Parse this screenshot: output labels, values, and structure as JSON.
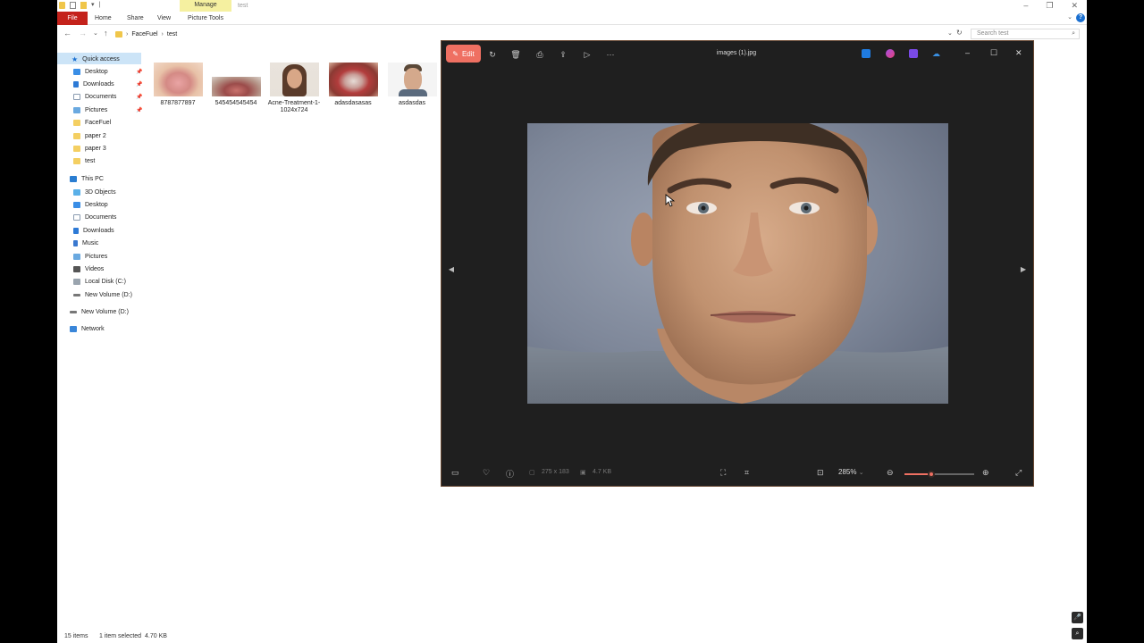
{
  "ribbon": {
    "file_tab": "File",
    "tabs": [
      "Home",
      "Share",
      "View"
    ],
    "context_group": "Manage",
    "context_tab": "Picture Tools",
    "window_title": "test"
  },
  "address": {
    "path": [
      "FaceFuel",
      "test"
    ],
    "search_placeholder": "Search test"
  },
  "nav_pane": {
    "quick_access_label": "Quick access",
    "quick_access": [
      {
        "label": "Desktop",
        "icon": "desktop-icon",
        "pinned": true
      },
      {
        "label": "Downloads",
        "icon": "download-icon",
        "pinned": true
      },
      {
        "label": "Documents",
        "icon": "document-icon",
        "pinned": true
      },
      {
        "label": "Pictures",
        "icon": "pictures-icon",
        "pinned": true
      },
      {
        "label": "FaceFuel",
        "icon": "folder-icon",
        "pinned": false
      },
      {
        "label": "paper 2",
        "icon": "folder-icon",
        "pinned": false
      },
      {
        "label": "paper 3",
        "icon": "folder-icon",
        "pinned": false
      },
      {
        "label": "test",
        "icon": "folder-icon",
        "pinned": false
      }
    ],
    "this_pc_label": "This PC",
    "this_pc": [
      {
        "label": "3D Objects",
        "icon": "3d-objects-icon"
      },
      {
        "label": "Desktop",
        "icon": "desktop-icon"
      },
      {
        "label": "Documents",
        "icon": "document-icon"
      },
      {
        "label": "Downloads",
        "icon": "download-icon"
      },
      {
        "label": "Music",
        "icon": "music-icon"
      },
      {
        "label": "Pictures",
        "icon": "pictures-icon"
      },
      {
        "label": "Videos",
        "icon": "videos-icon"
      },
      {
        "label": "Local Disk (C:)",
        "icon": "local-disk-icon"
      },
      {
        "label": "New Volume (D:)",
        "icon": "drive-icon"
      }
    ],
    "new_volume_label": "New Volume (D:)",
    "network_label": "Network"
  },
  "files": [
    {
      "name": "8787877897",
      "thumb": "tongue-thumbnail"
    },
    {
      "name": "545454545454",
      "thumb": "tongue-thumbnail"
    },
    {
      "name": "Acne-Treatment-1-1024x724",
      "thumb": "woman-portrait-thumbnail"
    },
    {
      "name": "adasdasasas",
      "thumb": "lips-thumbnail"
    },
    {
      "name": "asdasdas",
      "thumb": "man-portrait-thumbnail"
    }
  ],
  "status": {
    "item_count": "15 items",
    "selection": "1 item selected",
    "selection_size": "4.70 KB"
  },
  "viewer": {
    "edit_label": "Edit",
    "title": "images (1).jpg",
    "dimensions": "275 x 183",
    "file_size": "4.7 KB",
    "zoom_label": "285%",
    "zoom_fraction": 0.38,
    "accent": "#ef7062"
  }
}
